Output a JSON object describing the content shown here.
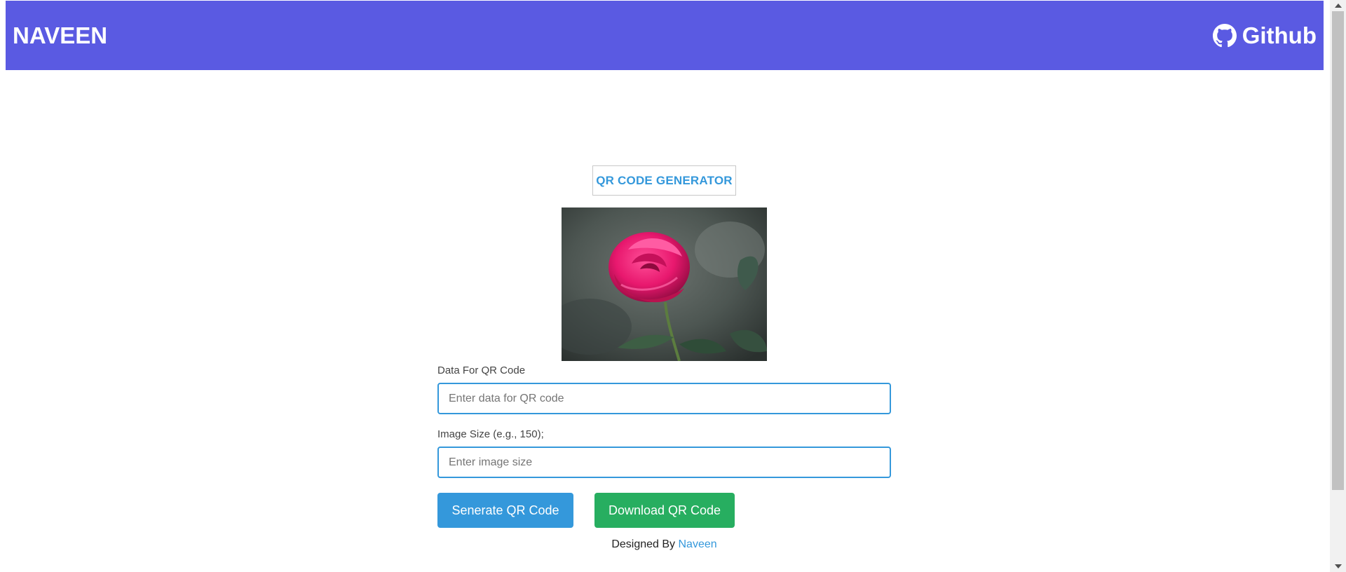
{
  "header": {
    "brand": "NAVEEN",
    "github_label": "Github",
    "background_color": "#5a5ae2"
  },
  "main": {
    "title": "QR CODE GENERATOR",
    "image_icon": "rose-photo",
    "data_field": {
      "label": "Data For QR Code",
      "placeholder": "Enter data for QR code",
      "value": ""
    },
    "size_field": {
      "label": "Image Size (e.g., 150);",
      "placeholder": "Enter image size",
      "value": ""
    },
    "buttons": {
      "generate_label": "Senerate QR Code",
      "download_label": "Download QR Code"
    }
  },
  "footer": {
    "prefix": "Designed By",
    "author_link": "Naveen"
  },
  "colors": {
    "accent_blue": "#3498db",
    "accent_green": "#27ae60"
  }
}
